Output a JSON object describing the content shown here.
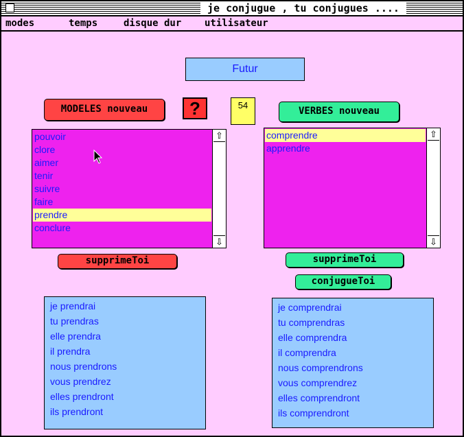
{
  "window": {
    "title": "je conjugue , tu conjugues ...."
  },
  "menubar": {
    "items": [
      "modes",
      "temps",
      "disque dur",
      "utilisateur"
    ]
  },
  "tense": "Futur",
  "counter": "54",
  "left": {
    "new_button": "MODELES nouveau",
    "help_label": "?",
    "list_items": [
      "pouvoir",
      "clore",
      "aimer",
      "tenir",
      "suivre",
      "faire",
      "prendre",
      "conclure"
    ],
    "selected_index": 6,
    "delete_button": "supprimeToi",
    "conjugation": [
      "je prendrai",
      "tu prendras",
      "elle prendra",
      "il prendra",
      "nous prendrons",
      "vous prendrez",
      "elles prendront",
      "ils prendront"
    ]
  },
  "right": {
    "new_button": "VERBES nouveau",
    "list_items": [
      "comprendre",
      "apprendre"
    ],
    "selected_index": 0,
    "delete_button": "supprimeToi",
    "conjugate_button": "conjugueToi",
    "conjugation": [
      "je comprendrai",
      "tu comprendras",
      "elle comprendra",
      "il comprendra",
      "nous comprendrons",
      "vous comprendrez",
      "elles comprendront",
      "ils comprendront"
    ]
  },
  "colors": {
    "background": "#ffccff",
    "list": "#ee22ee",
    "selection": "#ffff99",
    "field": "#99ccff",
    "red_button": "#ff4444",
    "green_button": "#33ee99"
  },
  "icons": {
    "close": "close-box-icon",
    "scroll_up": "scroll-up-arrow-icon",
    "scroll_down": "scroll-down-arrow-icon",
    "cursor": "mouse-pointer-icon"
  }
}
